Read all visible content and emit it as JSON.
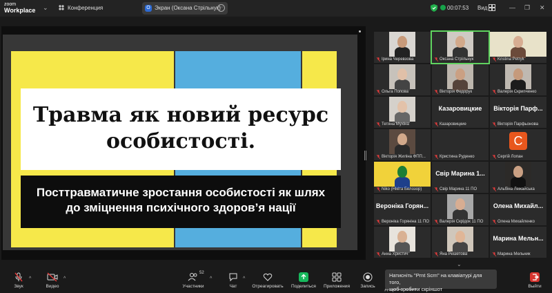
{
  "app": {
    "brand_line1": "zoom",
    "brand_line2": "Workplace",
    "meeting": "Конференция"
  },
  "screen_share": {
    "label": "Экран (Оксана Стрільнук)",
    "icon_letter": "O"
  },
  "status": {
    "timer": "00:07:53",
    "view_label": "Вид"
  },
  "slide": {
    "title_line1": "Травма як новий ресурс",
    "title_line2": "особистості.",
    "subtitle_line1": "Посттравматичне зростання особистості як шлях",
    "subtitle_line2": "до зміцнення психічного здоров’я нації"
  },
  "participants": [
    {
      "label": "Ірина Черевзова",
      "type": "video"
    },
    {
      "label": "Оксана Стрільнук",
      "type": "video",
      "active": true
    },
    {
      "label": "Kristina Petryk",
      "type": "video"
    },
    {
      "label": "Ольга Попова",
      "type": "video"
    },
    {
      "label": "Вікторія Федорук",
      "type": "video"
    },
    {
      "label": "Валерія Скрипченко",
      "type": "video"
    },
    {
      "label": "Тетяна Мухіна",
      "type": "video"
    },
    {
      "label": "Казаровицкие",
      "type": "name",
      "display": "Казаровицкие"
    },
    {
      "label": "Вікторія Парфьонова",
      "type": "name",
      "display": "Вікторія Парф..."
    },
    {
      "label": "Вікторія Жиліна ФПП...",
      "type": "video"
    },
    {
      "label": "Кристина Руденко",
      "type": "name",
      "display": ""
    },
    {
      "label": "Сергій Лопан",
      "type": "avatar",
      "avatar": "C"
    },
    {
      "label": "Niko (Нікіта Белозор)",
      "type": "video"
    },
    {
      "label": "Свір Марина 11 ПО",
      "type": "name",
      "display": "Свір Марина 1..."
    },
    {
      "label": "Альбіна Лежайська",
      "type": "video"
    },
    {
      "label": "Вероніка Горяніна 11 ПО",
      "type": "name",
      "display": "Вероніка Горян..."
    },
    {
      "label": "Валерія Скрідок 11 ПО",
      "type": "video"
    },
    {
      "label": "Олена Михайленко",
      "type": "name",
      "display": "Олена Михайл..."
    },
    {
      "label": "Анна Христич",
      "type": "video"
    },
    {
      "label": "Яна Решетова",
      "type": "video"
    },
    {
      "label": "Марина Мельник",
      "type": "name",
      "display": "Марина Мельн..."
    }
  ],
  "toolbar": {
    "audio": "Звук",
    "video": "Видео",
    "participants": "Участники",
    "participants_count": "52",
    "chat": "Чат",
    "react": "Отреагировать",
    "share": "Поделиться",
    "apps": "Приложения",
    "record": "Запись",
    "more": "Дополнительно",
    "leave": "Выйти"
  },
  "tooltip": {
    "line1": "Натисніть \"Prnt Scrn\" на клавіатурі для того,",
    "line2": "щоб зробити скріншот"
  },
  "colors": {
    "slide_yellow": "#f6e84a",
    "slide_blue": "#55aede",
    "active_border": "#5fd35f",
    "share_green": "#17b85c",
    "accent_blue": "#2d6ad3"
  }
}
